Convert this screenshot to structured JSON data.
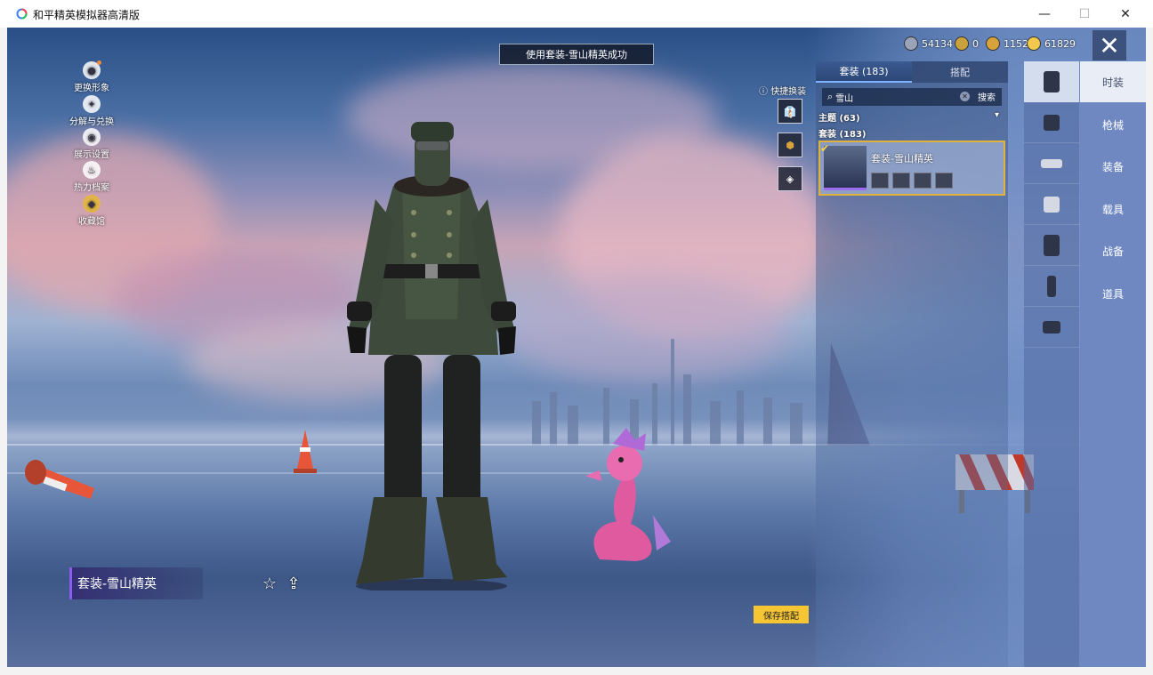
{
  "window": {
    "title": "和平精英模拟器高清版",
    "minimize": "—",
    "maximize": "☐",
    "close": "✕"
  },
  "toast": "使用套装-雪山精英成功",
  "currencies": [
    {
      "icon": "silver-coin-icon",
      "value": "54134",
      "color": "#9aa3b8"
    },
    {
      "icon": "bronze-medal-icon",
      "value": "0",
      "color": "#c9a23c"
    },
    {
      "icon": "gold-token-icon",
      "value": "1152",
      "color": "#d8a23a"
    },
    {
      "icon": "gold-coin-icon",
      "value": "61829",
      "color": "#f2c94c"
    }
  ],
  "left_menu": [
    {
      "icon": "person-icon",
      "label": "更换形象"
    },
    {
      "icon": "decompose-icon",
      "label": "分解与兑换"
    },
    {
      "icon": "eye-icon",
      "label": "展示设置"
    },
    {
      "icon": "fire-icon",
      "label": "热力档案"
    },
    {
      "icon": "collection-icon",
      "label": "收藏馆"
    }
  ],
  "quick_change": {
    "label": "快捷换装",
    "slot_number": "4"
  },
  "outfit_panel": {
    "tab_active": "套装 (183)",
    "tab_inactive": "搭配",
    "search_value": "雪山",
    "search_button": "搜索",
    "theme_label": "主题 (63)",
    "suit_label": "套装 (183)",
    "item_name": "套装-雪山精英"
  },
  "categories": [
    {
      "icon": "suit-icon"
    },
    {
      "icon": "helmet-icon"
    },
    {
      "icon": "glasses-icon"
    },
    {
      "icon": "mask-icon"
    },
    {
      "icon": "jacket-icon"
    },
    {
      "icon": "pants-icon"
    },
    {
      "icon": "shoes-icon"
    }
  ],
  "side_tabs": [
    "时装",
    "枪械",
    "装备",
    "载具",
    "战备",
    "道具"
  ],
  "character": {
    "outfit_name": "套装-雪山精英",
    "save_button": "保存搭配"
  },
  "colors": {
    "accent_gold": "#f6c534",
    "accent_purple": "#8a5cf0",
    "panel_blue": "#6f88c2"
  }
}
